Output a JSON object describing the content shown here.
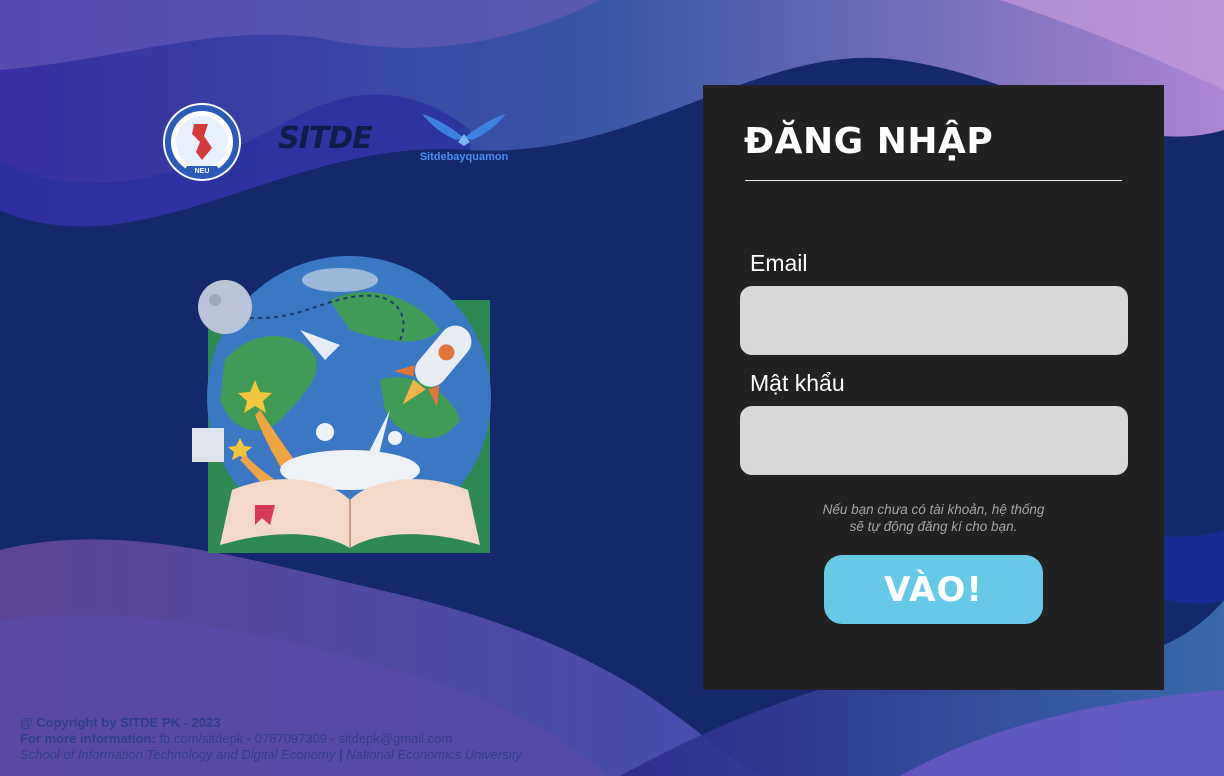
{
  "logos": {
    "neu_text": "NEU",
    "sitde_text": "SITDE",
    "sitdebay_text": "Sitdebayquamon"
  },
  "login": {
    "title": "ĐĂNG NHẬP",
    "email_label": "Email",
    "email_value": "",
    "password_label": "Mật khẩu",
    "password_value": "",
    "note_line1": "Nếu bạn chưa có tài khoản, hệ thống",
    "note_line2": "sẽ tự động đăng kí cho bạn.",
    "submit_label": "VÀO!"
  },
  "footer": {
    "copyright": "@ Copyright by SITDE PK - 2023",
    "info_label": "For more information:",
    "info_value": " fb.com/sitdepk - 0787097309 - sitdepk@gmail.com",
    "school": "School of Information Technology and Digital Economy",
    "separator": " | ",
    "university": "National Economics University"
  },
  "colors": {
    "panel": "#212121",
    "field": "#d9d9d9",
    "button": "#67c9e8",
    "background": "#13286a"
  }
}
